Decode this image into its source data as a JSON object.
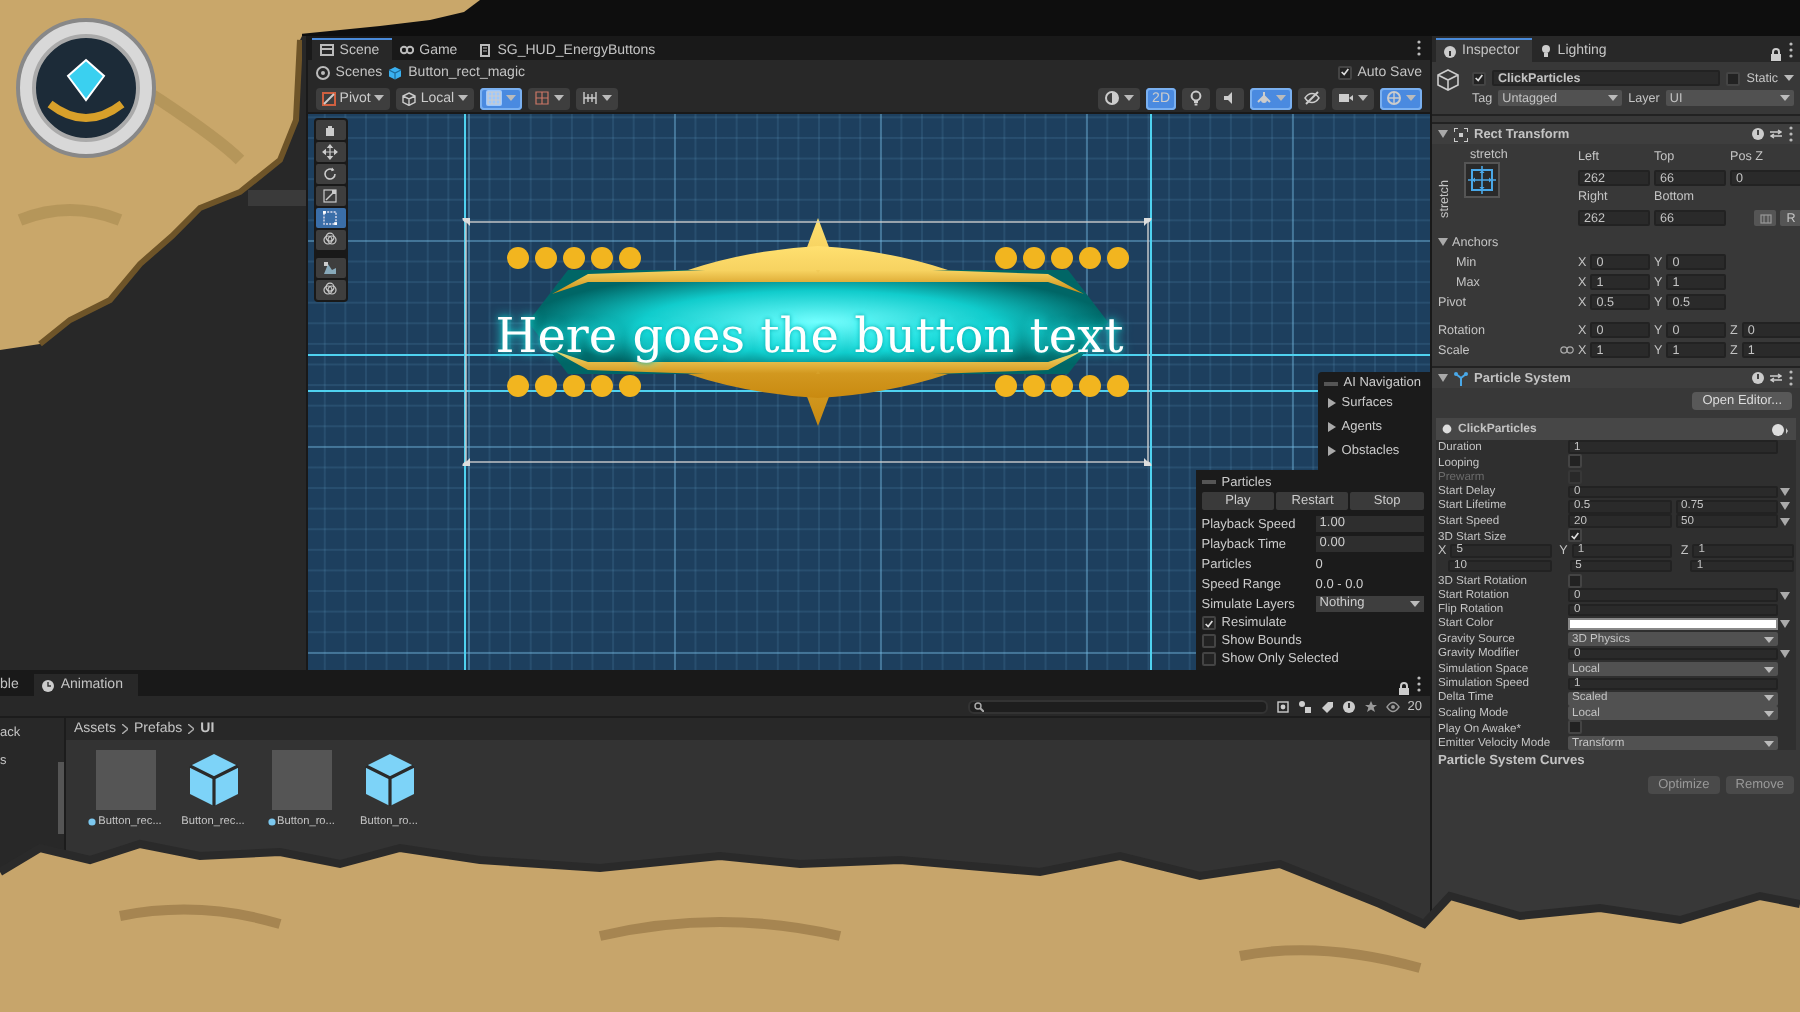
{
  "editor_tabs": [
    {
      "label": "Scene",
      "selected": true
    },
    {
      "label": "Game",
      "selected": false
    },
    {
      "label": "SG_HUD_EnergyButtons",
      "selected": false
    }
  ],
  "breadcrumb": {
    "items": [
      "Scenes",
      "Button_rect_magic"
    ],
    "auto_save": {
      "label": "Auto Save",
      "checked": true
    }
  },
  "scene_toolbar": {
    "pivot": "Pivot",
    "space": "Local",
    "left_tools": [
      {
        "kind": "grid",
        "selected": true
      },
      {
        "kind": "snap",
        "selected": false
      },
      {
        "kind": "increment",
        "selected": false
      }
    ],
    "right_tools": [
      {
        "kind": "shading",
        "selected": false
      },
      {
        "kind": "label",
        "label": "2D",
        "selected": true
      },
      {
        "kind": "light",
        "selected": false
      },
      {
        "kind": "audio",
        "selected": false
      },
      {
        "kind": "effects",
        "selected": true
      },
      {
        "kind": "hidden",
        "selected": false
      },
      {
        "kind": "camera",
        "selected": false
      },
      {
        "kind": "gizmos",
        "selected": true
      }
    ]
  },
  "tools": [
    {
      "kind": "hand",
      "selected": false
    },
    {
      "kind": "move",
      "selected": false
    },
    {
      "kind": "rotate",
      "selected": false
    },
    {
      "kind": "scale",
      "selected": false
    },
    {
      "kind": "rect",
      "selected": true
    },
    {
      "kind": "transform",
      "selected": false
    },
    {
      "kind": "custom",
      "selected": false
    },
    {
      "kind": "transform",
      "selected": false
    }
  ],
  "scene": {
    "button_text": "Here goes the button text",
    "ai_navigation": {
      "title": "AI Navigation",
      "items": [
        "Surfaces",
        "Agents",
        "Obstacles"
      ]
    },
    "particles": {
      "title": "Particles",
      "buttons": [
        "Play",
        "Restart",
        "Stop"
      ],
      "rows": [
        {
          "kind": "field",
          "label": "Playback Speed",
          "value": "1.00"
        },
        {
          "kind": "field",
          "label": "Playback Time",
          "value": "0.00"
        },
        {
          "kind": "value",
          "label": "Particles",
          "value": "0"
        },
        {
          "kind": "value",
          "label": "Speed Range",
          "value": "0.0 - 0.0"
        },
        {
          "kind": "select",
          "label": "Simulate Layers",
          "value": "Nothing"
        }
      ],
      "toggles": [
        {
          "label": "Resimulate",
          "checked": true
        },
        {
          "label": "Show Bounds",
          "checked": false
        },
        {
          "label": "Show Only Selected",
          "checked": false
        }
      ]
    }
  },
  "inspector": {
    "tabs": [
      {
        "label": "Inspector",
        "selected": true
      },
      {
        "label": "Lighting",
        "selected": false
      }
    ],
    "object": {
      "name": "ClickParticles",
      "active": true,
      "static_label": "Static",
      "static": false,
      "tag_label": "Tag",
      "tag": "Untagged",
      "layer_label": "Layer",
      "layer": "UI"
    },
    "rect_transform": {
      "title": "Rect Transform",
      "preset_labels": [
        "stretch",
        "stretch"
      ],
      "offsets": [
        {
          "label": "Left",
          "value": "262"
        },
        {
          "label": "Top",
          "value": "66"
        },
        {
          "label": "Pos Z",
          "value": "0"
        },
        {
          "label": "Right",
          "value": "262"
        },
        {
          "label": "Bottom",
          "value": "66"
        }
      ],
      "raw_button": "R",
      "anchors_label": "Anchors",
      "rows": [
        {
          "label": "Min",
          "indent": true,
          "fields": [
            {
              "axis": "X",
              "value": "0"
            },
            {
              "axis": "Y",
              "value": "0"
            }
          ]
        },
        {
          "label": "Max",
          "indent": true,
          "fields": [
            {
              "axis": "X",
              "value": "1"
            },
            {
              "axis": "Y",
              "value": "1"
            }
          ]
        },
        {
          "label": "Pivot",
          "indent": false,
          "fields": [
            {
              "axis": "X",
              "value": "0.5"
            },
            {
              "axis": "Y",
              "value": "0.5"
            }
          ]
        },
        {
          "label": "Rotation",
          "indent": false,
          "fields": [
            {
              "axis": "X",
              "value": "0"
            },
            {
              "axis": "Y",
              "value": "0"
            },
            {
              "axis": "Z",
              "value": "0"
            }
          ]
        },
        {
          "label": "Scale",
          "indent": false,
          "linked": true,
          "fields": [
            {
              "axis": "X",
              "value": "1"
            },
            {
              "axis": "Y",
              "value": "1"
            },
            {
              "axis": "Z",
              "value": "1"
            }
          ]
        }
      ]
    },
    "particle_system": {
      "title": "Particle System",
      "open_editor": "Open Editor...",
      "module": "ClickParticles",
      "rows": [
        {
          "kind": "field",
          "label": "Duration",
          "value": "1",
          "dropdown": false
        },
        {
          "kind": "checkbox",
          "label": "Looping",
          "checked": false,
          "disabled": false
        },
        {
          "kind": "checkbox",
          "label": "Prewarm",
          "checked": false,
          "disabled": true
        },
        {
          "kind": "field",
          "label": "Start Delay",
          "value": "0",
          "dropdown": true
        },
        {
          "kind": "pair",
          "label": "Start Lifetime",
          "values": [
            "0.5",
            "0.75"
          ]
        },
        {
          "kind": "pair",
          "label": "Start Speed",
          "values": [
            "20",
            "50"
          ]
        },
        {
          "kind": "checkbox",
          "label": "3D Start Size",
          "checked": true,
          "disabled": false
        },
        {
          "kind": "xyz",
          "axes": [
            "X",
            "Y",
            "Z"
          ],
          "lines": [
            [
              "5",
              "1",
              "1"
            ],
            [
              "10",
              "5",
              "1"
            ]
          ]
        },
        {
          "kind": "checkbox",
          "label": "3D Start Rotation",
          "checked": false,
          "disabled": false
        },
        {
          "kind": "field",
          "label": "Start Rotation",
          "value": "0",
          "dropdown": true
        },
        {
          "kind": "field",
          "label": "Flip Rotation",
          "value": "0",
          "dropdown": false
        },
        {
          "kind": "color",
          "label": "Start Color",
          "color": "#ffffff"
        },
        {
          "kind": "select",
          "label": "Gravity Source",
          "value": "3D Physics"
        },
        {
          "kind": "field",
          "label": "Gravity Modifier",
          "value": "0",
          "dropdown": true
        },
        {
          "kind": "select",
          "label": "Simulation Space",
          "value": "Local"
        },
        {
          "kind": "field",
          "label": "Simulation Speed",
          "value": "1",
          "dropdown": false
        },
        {
          "kind": "select",
          "label": "Delta Time",
          "value": "Scaled"
        },
        {
          "kind": "select",
          "label": "Scaling Mode",
          "value": "Local"
        },
        {
          "kind": "checkbox",
          "label": "Play On Awake*",
          "checked": false,
          "disabled": false
        },
        {
          "kind": "select",
          "label": "Emitter Velocity Mode",
          "value": "Transform"
        }
      ],
      "curves": "Particle System Curves",
      "buttons": [
        "Optimize",
        "Remove"
      ]
    }
  },
  "bottom": {
    "tabs": [
      {
        "label": "ble",
        "selected": false
      },
      {
        "label": "Animation",
        "selected": true
      }
    ],
    "tree_items": [
      "ack",
      "s"
    ],
    "count": "20",
    "path": [
      "Assets",
      "Prefabs",
      "UI"
    ],
    "assets": [
      {
        "kind": "sprite",
        "name": "Button_rec..."
      },
      {
        "kind": "prefab",
        "name": "Button_rec..."
      },
      {
        "kind": "sprite",
        "name": "Button_ro..."
      },
      {
        "kind": "prefab",
        "name": "Button_ro..."
      }
    ]
  }
}
